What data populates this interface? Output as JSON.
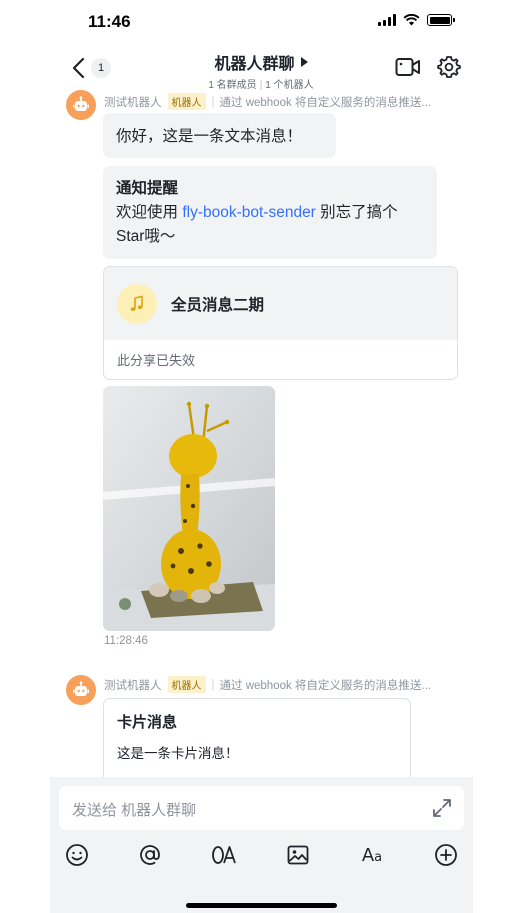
{
  "status_bar": {
    "time": "11:46"
  },
  "nav": {
    "back_count": "1",
    "title": "机器人群聊",
    "members": "1 名群成员",
    "robots": "1 个机器人"
  },
  "messages": [
    {
      "sender": "测试机器人",
      "tag": "机器人",
      "description": "通过 webhook 将自定义服务的消息推送...",
      "text": "你好，这是一条文本消息！",
      "notice": {
        "title": "通知提醒",
        "text_before": "欢迎使用 ",
        "link": "fly-book-bot-sender",
        "text_after": " 别忘了搞个Star哦～"
      },
      "share": {
        "title": "全员消息二期",
        "status": "此分享已失效"
      },
      "time": "11:28:46"
    },
    {
      "sender": "测试机器人",
      "tag": "机器人",
      "description": "通过 webhook 将自定义服务的消息推送...",
      "card": {
        "title": "卡片消息",
        "body": "这是一条卡片消息！"
      }
    }
  ],
  "composer": {
    "placeholder": "发送给 机器人群聊"
  },
  "colors": {
    "accent": "#3370ff",
    "avatar": "#f6a05a",
    "tag_bg": "#fdf1cc"
  }
}
